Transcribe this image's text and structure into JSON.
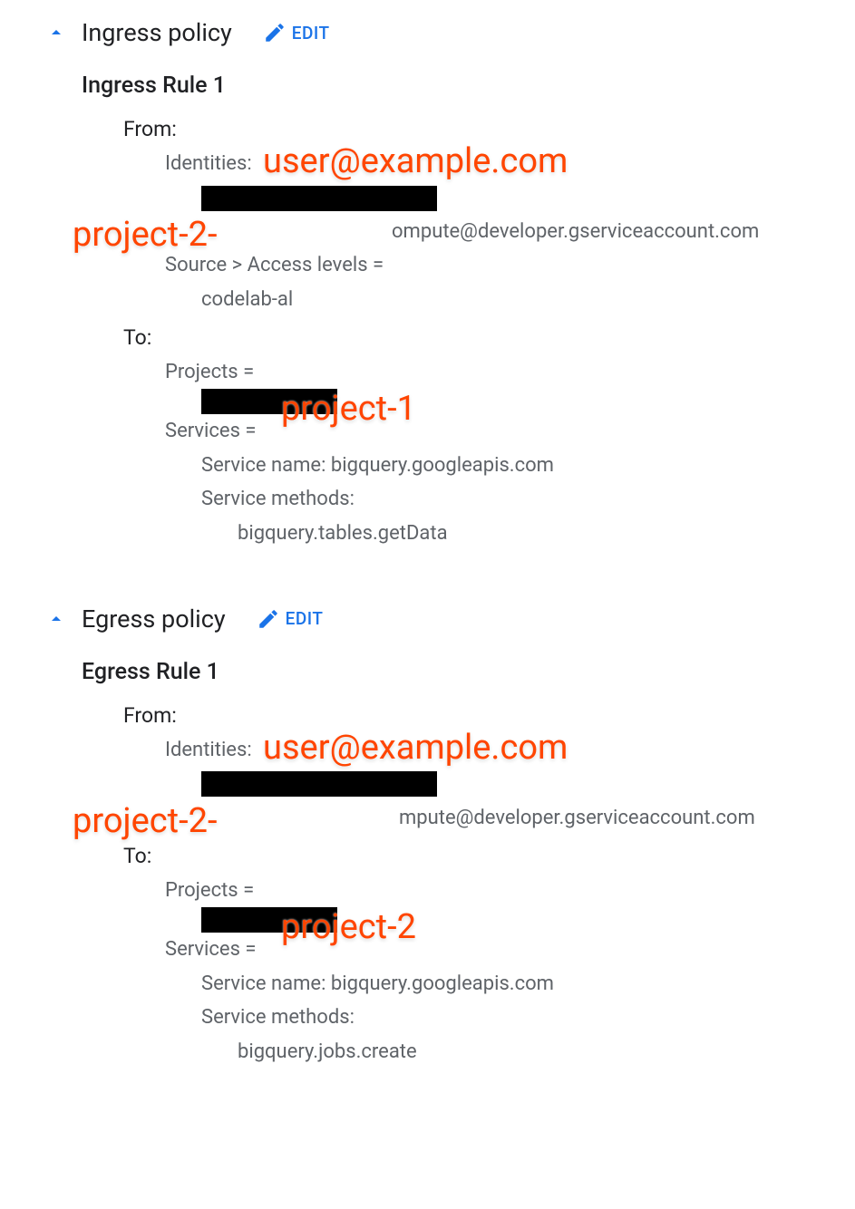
{
  "ingress": {
    "header": "Ingress policy",
    "edit": "EDIT",
    "rule_title": "Ingress Rule 1",
    "from_label": "From:",
    "identities_label": "Identities:",
    "sa_suffix": "ompute@developer.gserviceaccount.com",
    "src_access": "Source > Access levels =",
    "access_level": "codelab-al",
    "to_label": "To:",
    "projects_label": "Projects =",
    "services_label": "Services =",
    "svc_name_label": "Service name:",
    "svc_name": "bigquery.googleapis.com",
    "svc_methods_label": "Service methods:",
    "svc_method": "bigquery.tables.getData"
  },
  "egress": {
    "header": "Egress policy",
    "edit": "EDIT",
    "rule_title": "Egress Rule 1",
    "from_label": "From:",
    "identities_label": "Identities:",
    "sa_suffix": "mpute@developer.gserviceaccount.com",
    "to_label": "To:",
    "projects_label": "Projects =",
    "services_label": "Services =",
    "svc_name_label": "Service name:",
    "svc_name": "bigquery.googleapis.com",
    "svc_methods_label": "Service methods:",
    "svc_method": "bigquery.jobs.create"
  },
  "annotations": {
    "user_email": "user@example.com",
    "project2dash": "project-2-",
    "project1": "project-1",
    "project2": "project-2"
  }
}
